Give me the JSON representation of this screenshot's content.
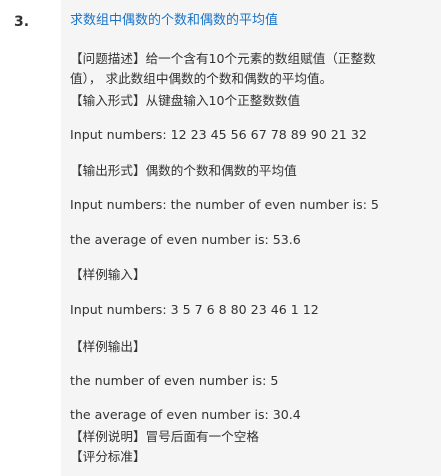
{
  "question": {
    "number": "3.",
    "title": "求数组中偶数的个数和偶数的平均值",
    "lines": [
      "【问题描述】给一个含有10个元素的数组赋值（正整数",
      "值）， 求此数组中偶数的个数和偶数的平均值。",
      "【输入形式】从键盘输入10个正整数数值",
      "Input numbers:  12 23 45 56 67 78 89 90 21 32",
      "【输出形式】偶数的个数和偶数的平均值",
      "Input numbers: the number of even number is: 5",
      "the average of even number is: 53.6",
      "【样例输入】",
      "Input numbers:  3 5 7 6 8 80 23 46 1 12",
      "【样例输出】",
      "the number of even number is:  5",
      "the average of even number is:  30.4",
      "【样例说明】冒号后面有一个空格",
      "【评分标准】"
    ]
  }
}
